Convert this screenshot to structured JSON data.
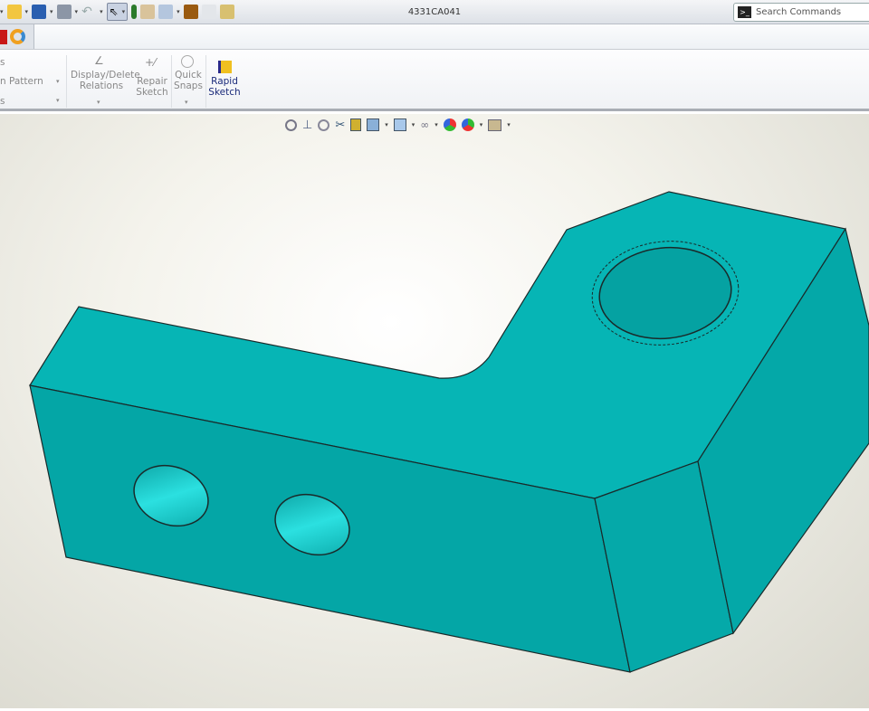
{
  "window": {
    "title": "4331CA041"
  },
  "search": {
    "placeholder": "Search Commands"
  },
  "quick_access": {
    "icons": [
      "new-dropdown",
      "open-icon",
      "save-icon",
      "print-icon",
      "undo-icon",
      "select-icon",
      "rebuild-icon",
      "file-properties-icon",
      "options-icon",
      "bt-icon",
      "copy-icon",
      "paste-icon"
    ]
  },
  "ribbon": {
    "left_items": [
      "s",
      "n Pattern",
      "s"
    ],
    "display_delete_relations": "Display/Delete Relations",
    "repair_sketch": "Repair Sketch",
    "quick_snaps": "Quick Snaps",
    "rapid_sketch": "Rapid Sketch"
  },
  "view_toolbar": {
    "icons": [
      "zoom-to-fit",
      "zoom-to-area",
      "previous-view",
      "section-view",
      "view-orientation",
      "display-style",
      "hide-show-items",
      "edit-appearance",
      "apply-scene",
      "view-settings"
    ]
  },
  "colors": {
    "part": "#05b3b3",
    "part_side": "#03a3a3",
    "part_dark": "#049c9c",
    "edge": "#1a2a2a"
  }
}
